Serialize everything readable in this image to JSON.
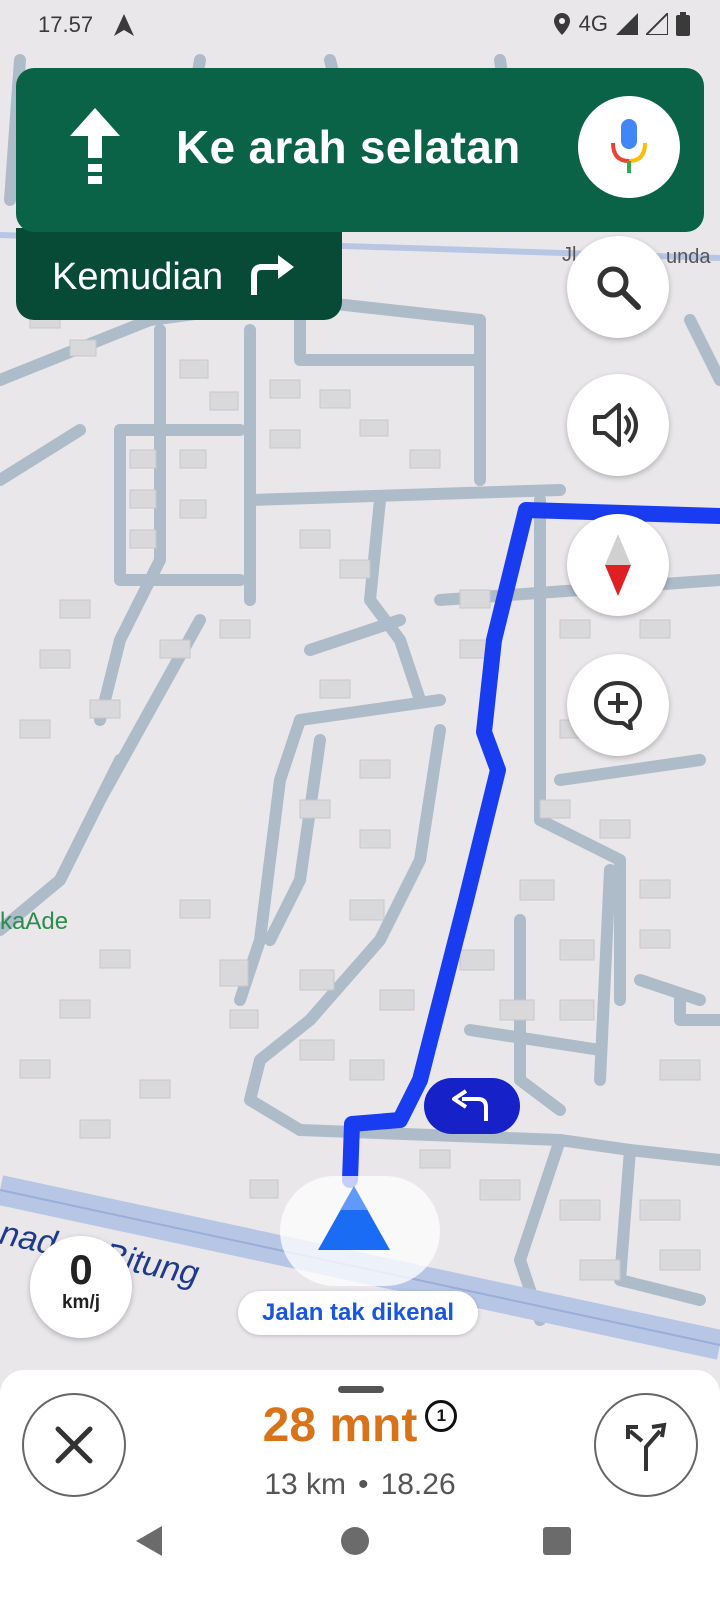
{
  "status": {
    "time": "17.57",
    "network": "4G"
  },
  "navigation": {
    "instruction": "Ke arah selatan",
    "then_label": "Kemudian",
    "current_street": "Jalan tak dikenal"
  },
  "map_labels": {
    "road_major": "anado - Bitung",
    "road_top_right": "Jl",
    "road_top_right_2": "unda",
    "place": "kaAde"
  },
  "speed": {
    "value": "0",
    "unit": "km/j"
  },
  "trip": {
    "duration": "28 mnt",
    "alt_routes_badge": "1",
    "distance": "13 km",
    "separator": "•",
    "arrival": "18.26"
  },
  "icons": {
    "mic": "mic-icon",
    "search": "search-icon",
    "volume": "volume-icon",
    "compass": "compass-icon",
    "report": "add-comment-icon",
    "close": "close-icon",
    "alternate_routes": "alt-route-icon"
  },
  "colors": {
    "banner": "#0b6347",
    "banner_dark": "#074b36",
    "route": "#1a3cf0",
    "eta": "#d8731a"
  }
}
